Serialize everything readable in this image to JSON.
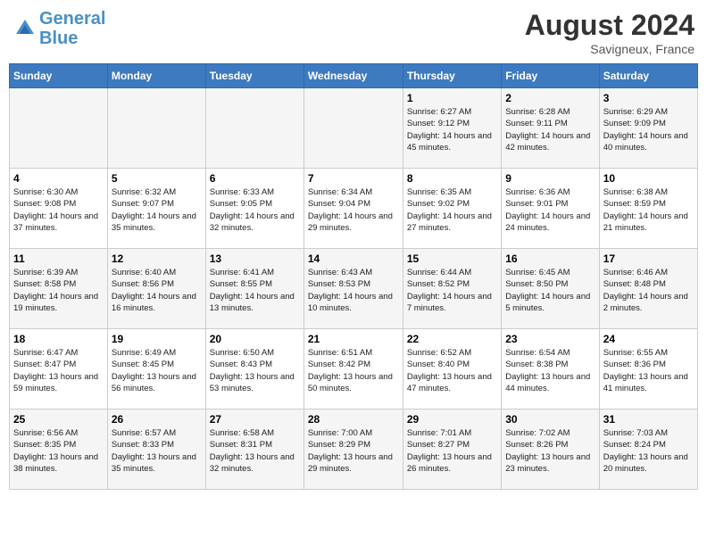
{
  "header": {
    "logo_line1": "General",
    "logo_line2": "Blue",
    "month_year": "August 2024",
    "location": "Savigneux, France"
  },
  "days_of_week": [
    "Sunday",
    "Monday",
    "Tuesday",
    "Wednesday",
    "Thursday",
    "Friday",
    "Saturday"
  ],
  "weeks": [
    [
      {
        "day": "",
        "info": ""
      },
      {
        "day": "",
        "info": ""
      },
      {
        "day": "",
        "info": ""
      },
      {
        "day": "",
        "info": ""
      },
      {
        "day": "1",
        "info": "Sunrise: 6:27 AM\nSunset: 9:12 PM\nDaylight: 14 hours and 45 minutes."
      },
      {
        "day": "2",
        "info": "Sunrise: 6:28 AM\nSunset: 9:11 PM\nDaylight: 14 hours and 42 minutes."
      },
      {
        "day": "3",
        "info": "Sunrise: 6:29 AM\nSunset: 9:09 PM\nDaylight: 14 hours and 40 minutes."
      }
    ],
    [
      {
        "day": "4",
        "info": "Sunrise: 6:30 AM\nSunset: 9:08 PM\nDaylight: 14 hours and 37 minutes."
      },
      {
        "day": "5",
        "info": "Sunrise: 6:32 AM\nSunset: 9:07 PM\nDaylight: 14 hours and 35 minutes."
      },
      {
        "day": "6",
        "info": "Sunrise: 6:33 AM\nSunset: 9:05 PM\nDaylight: 14 hours and 32 minutes."
      },
      {
        "day": "7",
        "info": "Sunrise: 6:34 AM\nSunset: 9:04 PM\nDaylight: 14 hours and 29 minutes."
      },
      {
        "day": "8",
        "info": "Sunrise: 6:35 AM\nSunset: 9:02 PM\nDaylight: 14 hours and 27 minutes."
      },
      {
        "day": "9",
        "info": "Sunrise: 6:36 AM\nSunset: 9:01 PM\nDaylight: 14 hours and 24 minutes."
      },
      {
        "day": "10",
        "info": "Sunrise: 6:38 AM\nSunset: 8:59 PM\nDaylight: 14 hours and 21 minutes."
      }
    ],
    [
      {
        "day": "11",
        "info": "Sunrise: 6:39 AM\nSunset: 8:58 PM\nDaylight: 14 hours and 19 minutes."
      },
      {
        "day": "12",
        "info": "Sunrise: 6:40 AM\nSunset: 8:56 PM\nDaylight: 14 hours and 16 minutes."
      },
      {
        "day": "13",
        "info": "Sunrise: 6:41 AM\nSunset: 8:55 PM\nDaylight: 14 hours and 13 minutes."
      },
      {
        "day": "14",
        "info": "Sunrise: 6:43 AM\nSunset: 8:53 PM\nDaylight: 14 hours and 10 minutes."
      },
      {
        "day": "15",
        "info": "Sunrise: 6:44 AM\nSunset: 8:52 PM\nDaylight: 14 hours and 7 minutes."
      },
      {
        "day": "16",
        "info": "Sunrise: 6:45 AM\nSunset: 8:50 PM\nDaylight: 14 hours and 5 minutes."
      },
      {
        "day": "17",
        "info": "Sunrise: 6:46 AM\nSunset: 8:48 PM\nDaylight: 14 hours and 2 minutes."
      }
    ],
    [
      {
        "day": "18",
        "info": "Sunrise: 6:47 AM\nSunset: 8:47 PM\nDaylight: 13 hours and 59 minutes."
      },
      {
        "day": "19",
        "info": "Sunrise: 6:49 AM\nSunset: 8:45 PM\nDaylight: 13 hours and 56 minutes."
      },
      {
        "day": "20",
        "info": "Sunrise: 6:50 AM\nSunset: 8:43 PM\nDaylight: 13 hours and 53 minutes."
      },
      {
        "day": "21",
        "info": "Sunrise: 6:51 AM\nSunset: 8:42 PM\nDaylight: 13 hours and 50 minutes."
      },
      {
        "day": "22",
        "info": "Sunrise: 6:52 AM\nSunset: 8:40 PM\nDaylight: 13 hours and 47 minutes."
      },
      {
        "day": "23",
        "info": "Sunrise: 6:54 AM\nSunset: 8:38 PM\nDaylight: 13 hours and 44 minutes."
      },
      {
        "day": "24",
        "info": "Sunrise: 6:55 AM\nSunset: 8:36 PM\nDaylight: 13 hours and 41 minutes."
      }
    ],
    [
      {
        "day": "25",
        "info": "Sunrise: 6:56 AM\nSunset: 8:35 PM\nDaylight: 13 hours and 38 minutes."
      },
      {
        "day": "26",
        "info": "Sunrise: 6:57 AM\nSunset: 8:33 PM\nDaylight: 13 hours and 35 minutes."
      },
      {
        "day": "27",
        "info": "Sunrise: 6:58 AM\nSunset: 8:31 PM\nDaylight: 13 hours and 32 minutes."
      },
      {
        "day": "28",
        "info": "Sunrise: 7:00 AM\nSunset: 8:29 PM\nDaylight: 13 hours and 29 minutes."
      },
      {
        "day": "29",
        "info": "Sunrise: 7:01 AM\nSunset: 8:27 PM\nDaylight: 13 hours and 26 minutes."
      },
      {
        "day": "30",
        "info": "Sunrise: 7:02 AM\nSunset: 8:26 PM\nDaylight: 13 hours and 23 minutes."
      },
      {
        "day": "31",
        "info": "Sunrise: 7:03 AM\nSunset: 8:24 PM\nDaylight: 13 hours and 20 minutes."
      }
    ]
  ]
}
